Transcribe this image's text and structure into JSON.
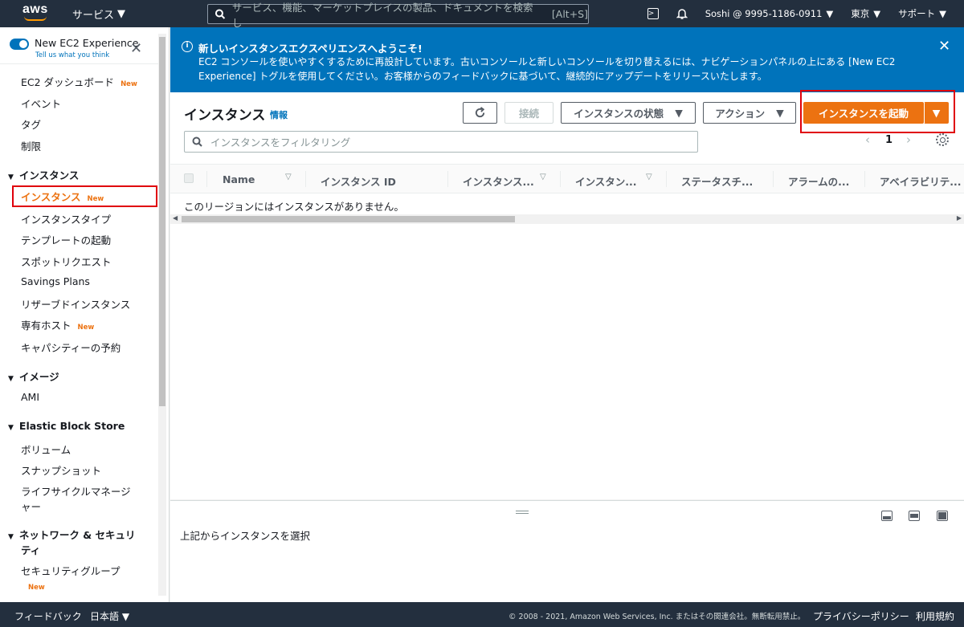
{
  "topnav": {
    "logo": "aws",
    "services": "サービス",
    "search_placeholder": "サービス、機能、マーケットプレイスの製品、ドキュメントを検索し",
    "search_shortcut": "[Alt+S]",
    "account": "Soshi @ 9995-1186-0911",
    "region": "東京",
    "support": "サポート"
  },
  "sidebar": {
    "toggle_label": "New EC2 Experience",
    "toggle_sub": "Tell us what you think",
    "new_badge": "New",
    "items": {
      "dashboard": "EC2 ダッシュボード",
      "events": "イベント",
      "tags": "タグ",
      "limits": "制限",
      "instances": "インスタンス",
      "instance_types": "インスタンスタイプ",
      "launch_templates": "テンプレートの起動",
      "spot_requests": "スポットリクエスト",
      "savings_plans": "Savings Plans",
      "reserved": "リザーブドインスタンス",
      "dedicated_hosts": "専有ホスト",
      "capacity": "キャパシティーの予約",
      "ami": "AMI",
      "volumes": "ボリューム",
      "snapshots": "スナップショット",
      "lifecycle_1": "ライフサイクルマネージ",
      "lifecycle_2": "ャー",
      "security_groups": "セキュリティグループ"
    },
    "sections": {
      "instances": "インスタンス",
      "images": "イメージ",
      "ebs": "Elastic Block Store",
      "network_1": "ネットワーク & セキュリ",
      "network_2": "ティ"
    }
  },
  "flash": {
    "title": "新しいインスタンスエクスペリエンスへようこそ!",
    "body": "EC2 コンソールを使いやすくするために再設計しています。古いコンソールと新しいコンソールを切り替えるには、ナビゲーションパネルの上にある [New EC2 Experience] トグルを使用してください。お客様からのフィードバックに基づいて、継続的にアップデートをリリースいたします。"
  },
  "main": {
    "title": "インスタンス",
    "info": "情報",
    "buttons": {
      "connect": "接続",
      "state": "インスタンスの状態",
      "actions": "アクション",
      "launch": "インスタンスを起動"
    },
    "filter_placeholder": "インスタンスをフィルタリング",
    "page": "1",
    "columns": [
      "Name",
      "インスタンス ID",
      "インスタンス...",
      "インスタン...",
      "ステータスチ...",
      "アラームの...",
      "アベイラビリテ..."
    ],
    "empty_text": "このリージョンにはインスタンスがありません。"
  },
  "split": {
    "text": "上記からインスタンスを選択"
  },
  "footer": {
    "feedback": "フィードバック",
    "language": "日本語",
    "copyright": "© 2008 - 2021, Amazon Web Services, Inc. またはその関連会社。無断転用禁止。",
    "privacy": "プライバシーポリシー",
    "terms": "利用規約"
  },
  "colors": {
    "nav_bg": "#232f3e",
    "accent_orange": "#ec7211",
    "flash_blue": "#0073bb",
    "highlight_red": "#e0000b"
  }
}
